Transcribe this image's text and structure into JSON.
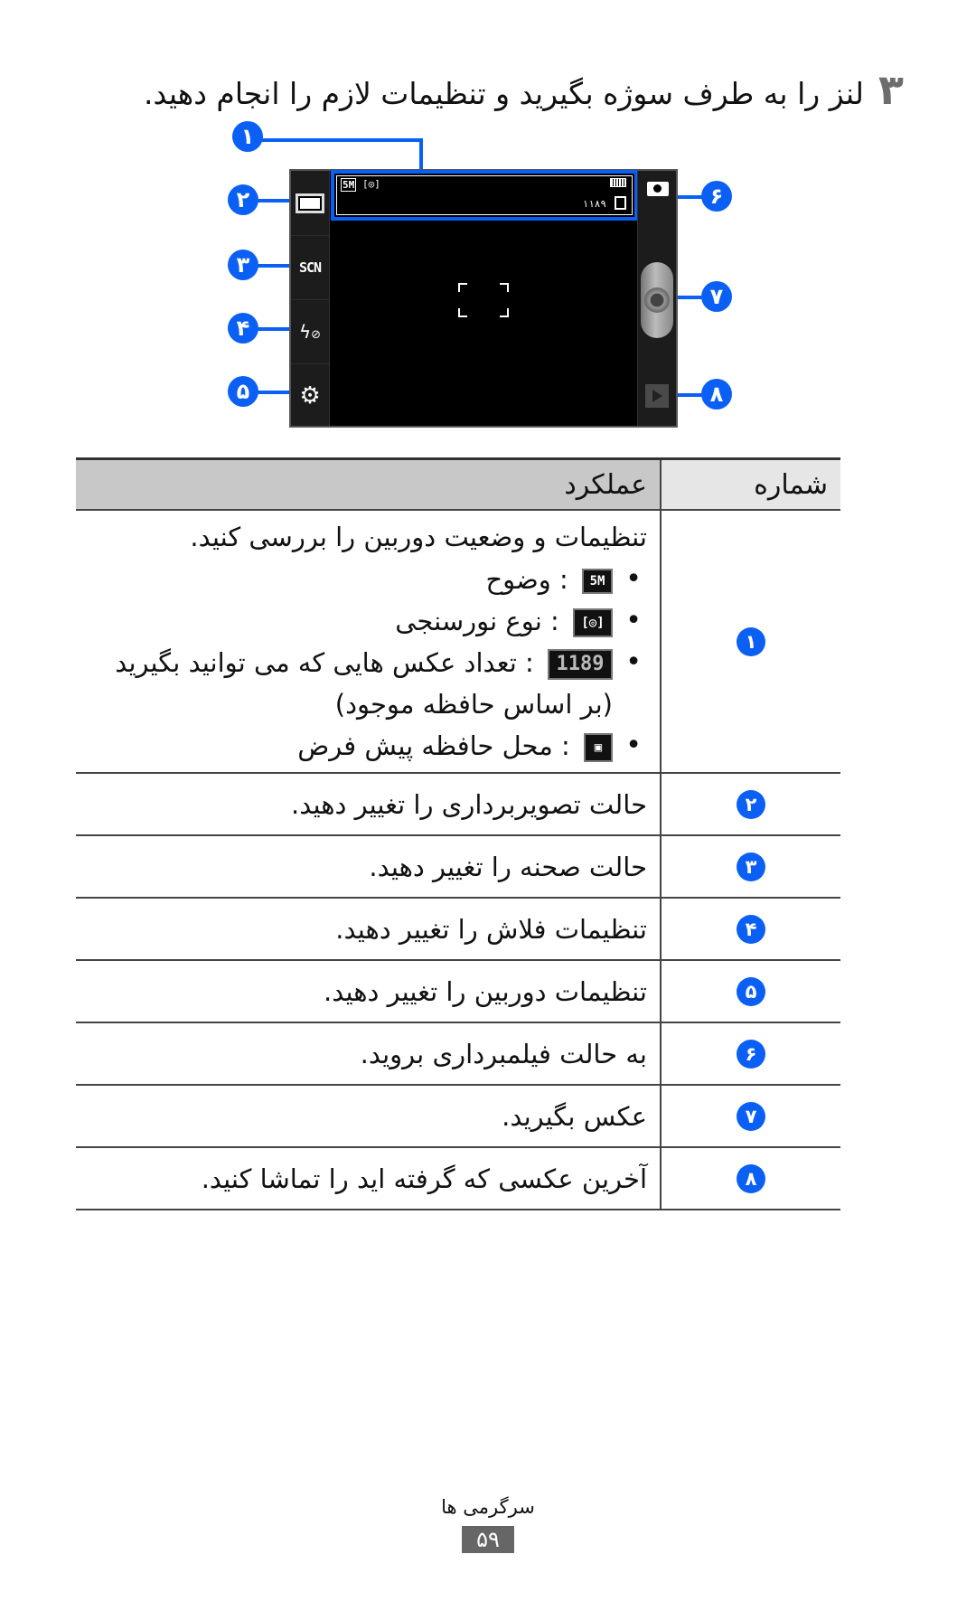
{
  "step": {
    "number": "۳",
    "text": "لنز را به طرف سوژه بگیرید و تنظیمات لازم را انجام دهید."
  },
  "camera_screen": {
    "left_controls": [
      {
        "callout": "۲",
        "icon": "shooting-mode-icon"
      },
      {
        "callout": "۳",
        "icon": "scene-mode-icon",
        "label": "SCN"
      },
      {
        "callout": "۴",
        "icon": "flash-off-icon"
      },
      {
        "callout": "۵",
        "icon": "settings-gear-icon"
      }
    ],
    "right_controls": [
      {
        "callout": "۶",
        "icon": "camera-mode-switch-icon"
      },
      {
        "callout": "۷",
        "icon": "shutter-button-icon"
      },
      {
        "callout": "۸",
        "icon": "play-preview-icon"
      }
    ],
    "status_callout": "۱",
    "status": {
      "resolution": "5M",
      "metering": "[◎]",
      "remaining_shots": "۱۱۸۹",
      "storage": "phone-memory"
    }
  },
  "table": {
    "headers": {
      "number": "شماره",
      "function": "عملکرد"
    },
    "rows": [
      {
        "number": "۱",
        "intro": "تنظیمات و وضعیت دوربین را بررسی کنید.",
        "bullets": [
          {
            "icon": "resolution-5m-icon",
            "icon_text": "5M",
            "text": ": وضوح"
          },
          {
            "icon": "metering-icon",
            "icon_text": "[◎]",
            "text": ": نوع نورسنجی"
          },
          {
            "icon": "shot-count-icon",
            "icon_text": "1189",
            "text": ": تعداد عکس هایی که می توانید بگیرید",
            "text2": "(بر اساس حافظه موجود)"
          },
          {
            "icon": "storage-location-icon",
            "icon_text": "▣",
            "text": ": محل حافظه پیش فرض"
          }
        ]
      },
      {
        "number": "۲",
        "text": "حالت تصویربرداری را تغییر دهید."
      },
      {
        "number": "۳",
        "text": "حالت صحنه را تغییر دهید."
      },
      {
        "number": "۴",
        "text": "تنظیمات فلاش را تغییر دهید."
      },
      {
        "number": "۵",
        "text": "تنظیمات دوربین را تغییر دهید."
      },
      {
        "number": "۶",
        "text": "به حالت فیلمبرداری بروید."
      },
      {
        "number": "۷",
        "text": "عکس بگیرید."
      },
      {
        "number": "۸",
        "text": "آخرین عکسی که گرفته اید را تماشا کنید."
      }
    ]
  },
  "footer": {
    "section": "سرگرمی ها",
    "page": "۵۹"
  },
  "colors": {
    "callout_blue": "#0a5ff5",
    "header_func_bg": "#c8c8c8",
    "header_num_bg": "#e6e6e6",
    "page_badge": "#666666"
  }
}
